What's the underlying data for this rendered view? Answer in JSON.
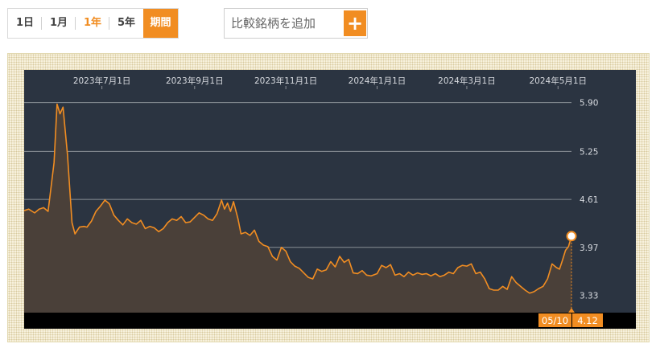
{
  "range_tabs": [
    {
      "label": "1日",
      "state": "normal"
    },
    {
      "label": "1月",
      "state": "normal"
    },
    {
      "label": "1年",
      "state": "active"
    },
    {
      "label": "5年",
      "state": "normal"
    },
    {
      "label": "期間",
      "state": "period"
    }
  ],
  "compare": {
    "placeholder": "比較銘柄を追加",
    "add_label": "+"
  },
  "colors": {
    "accent": "#f18d22",
    "plot_bg": "#2b3441",
    "grid": "#8a8f96",
    "text": "#d8dbe0",
    "area": "#4a4039"
  },
  "chart_data": {
    "type": "area",
    "x_range": [
      "2023-05-10",
      "2024-05-10"
    ],
    "ylim": [
      3.1,
      6.1
    ],
    "y_ticks": [
      5.9,
      5.25,
      4.61,
      3.97,
      3.33
    ],
    "y_tick_labels": [
      "5.90",
      "5.25",
      "4.61",
      "3.97",
      "3.33"
    ],
    "x_ticks": [
      {
        "date": "2023-07-01",
        "label": "2023年7月1日"
      },
      {
        "date": "2023-09-01",
        "label": "2023年9月1日"
      },
      {
        "date": "2023-11-01",
        "label": "2023年11月1日"
      },
      {
        "date": "2024-01-01",
        "label": "2024年1月1日"
      },
      {
        "date": "2024-03-01",
        "label": "2024年3月1日"
      },
      {
        "date": "2024-05-01",
        "label": "2024年5月1日"
      }
    ],
    "grid": true,
    "last_point": {
      "date_label": "05/10",
      "value_label": "4.12"
    },
    "series": [
      {
        "points": [
          [
            "2023-05-10",
            4.46
          ],
          [
            "2023-05-13",
            4.48
          ],
          [
            "2023-05-17",
            4.43
          ],
          [
            "2023-05-20",
            4.48
          ],
          [
            "2023-05-23",
            4.5
          ],
          [
            "2023-05-26",
            4.45
          ],
          [
            "2023-05-30",
            5.1
          ],
          [
            "2023-06-01",
            5.88
          ],
          [
            "2023-06-03",
            5.75
          ],
          [
            "2023-06-05",
            5.84
          ],
          [
            "2023-06-08",
            5.2
          ],
          [
            "2023-06-11",
            4.3
          ],
          [
            "2023-06-13",
            4.15
          ],
          [
            "2023-06-16",
            4.24
          ],
          [
            "2023-06-19",
            4.25
          ],
          [
            "2023-06-21",
            4.24
          ],
          [
            "2023-06-24",
            4.32
          ],
          [
            "2023-06-27",
            4.45
          ],
          [
            "2023-06-30",
            4.52
          ],
          [
            "2023-07-03",
            4.6
          ],
          [
            "2023-07-06",
            4.55
          ],
          [
            "2023-07-09",
            4.4
          ],
          [
            "2023-07-12",
            4.33
          ],
          [
            "2023-07-15",
            4.27
          ],
          [
            "2023-07-18",
            4.35
          ],
          [
            "2023-07-21",
            4.3
          ],
          [
            "2023-07-24",
            4.28
          ],
          [
            "2023-07-27",
            4.33
          ],
          [
            "2023-07-30",
            4.22
          ],
          [
            "2023-08-02",
            4.25
          ],
          [
            "2023-08-05",
            4.23
          ],
          [
            "2023-08-08",
            4.18
          ],
          [
            "2023-08-11",
            4.22
          ],
          [
            "2023-08-14",
            4.3
          ],
          [
            "2023-08-17",
            4.35
          ],
          [
            "2023-08-20",
            4.33
          ],
          [
            "2023-08-23",
            4.38
          ],
          [
            "2023-08-26",
            4.3
          ],
          [
            "2023-08-29",
            4.31
          ],
          [
            "2023-09-01",
            4.37
          ],
          [
            "2023-09-04",
            4.43
          ],
          [
            "2023-09-07",
            4.4
          ],
          [
            "2023-09-10",
            4.35
          ],
          [
            "2023-09-13",
            4.33
          ],
          [
            "2023-09-16",
            4.42
          ],
          [
            "2023-09-19",
            4.6
          ],
          [
            "2023-09-21",
            4.48
          ],
          [
            "2023-09-23",
            4.56
          ],
          [
            "2023-09-25",
            4.45
          ],
          [
            "2023-09-27",
            4.58
          ],
          [
            "2023-09-30",
            4.35
          ],
          [
            "2023-10-02",
            4.15
          ],
          [
            "2023-10-05",
            4.17
          ],
          [
            "2023-10-08",
            4.13
          ],
          [
            "2023-10-11",
            4.2
          ],
          [
            "2023-10-14",
            4.05
          ],
          [
            "2023-10-17",
            4.0
          ],
          [
            "2023-10-20",
            3.98
          ],
          [
            "2023-10-23",
            3.85
          ],
          [
            "2023-10-26",
            3.8
          ],
          [
            "2023-10-29",
            3.97
          ],
          [
            "2023-11-01",
            3.92
          ],
          [
            "2023-11-04",
            3.78
          ],
          [
            "2023-11-07",
            3.72
          ],
          [
            "2023-11-10",
            3.69
          ],
          [
            "2023-11-13",
            3.63
          ],
          [
            "2023-11-16",
            3.57
          ],
          [
            "2023-11-19",
            3.55
          ],
          [
            "2023-11-22",
            3.68
          ],
          [
            "2023-11-25",
            3.65
          ],
          [
            "2023-11-28",
            3.67
          ],
          [
            "2023-12-01",
            3.78
          ],
          [
            "2023-12-04",
            3.71
          ],
          [
            "2023-12-07",
            3.85
          ],
          [
            "2023-12-10",
            3.77
          ],
          [
            "2023-12-13",
            3.81
          ],
          [
            "2023-12-16",
            3.63
          ],
          [
            "2023-12-19",
            3.62
          ],
          [
            "2023-12-22",
            3.66
          ],
          [
            "2023-12-25",
            3.6
          ],
          [
            "2023-12-28",
            3.59
          ],
          [
            "2024-01-01",
            3.62
          ],
          [
            "2024-01-04",
            3.73
          ],
          [
            "2024-01-07",
            3.7
          ],
          [
            "2024-01-10",
            3.74
          ],
          [
            "2024-01-13",
            3.6
          ],
          [
            "2024-01-16",
            3.62
          ],
          [
            "2024-01-19",
            3.58
          ],
          [
            "2024-01-22",
            3.64
          ],
          [
            "2024-01-25",
            3.6
          ],
          [
            "2024-01-28",
            3.63
          ],
          [
            "2024-01-31",
            3.61
          ],
          [
            "2024-02-03",
            3.62
          ],
          [
            "2024-02-06",
            3.59
          ],
          [
            "2024-02-09",
            3.62
          ],
          [
            "2024-02-12",
            3.58
          ],
          [
            "2024-02-15",
            3.6
          ],
          [
            "2024-02-18",
            3.64
          ],
          [
            "2024-02-21",
            3.62
          ],
          [
            "2024-02-24",
            3.7
          ],
          [
            "2024-02-27",
            3.73
          ],
          [
            "2024-03-01",
            3.72
          ],
          [
            "2024-03-04",
            3.75
          ],
          [
            "2024-03-07",
            3.62
          ],
          [
            "2024-03-10",
            3.64
          ],
          [
            "2024-03-13",
            3.55
          ],
          [
            "2024-03-16",
            3.42
          ],
          [
            "2024-03-19",
            3.4
          ],
          [
            "2024-03-22",
            3.4
          ],
          [
            "2024-03-25",
            3.45
          ],
          [
            "2024-03-28",
            3.41
          ],
          [
            "2024-03-31",
            3.58
          ],
          [
            "2024-04-03",
            3.5
          ],
          [
            "2024-04-06",
            3.45
          ],
          [
            "2024-04-09",
            3.4
          ],
          [
            "2024-04-12",
            3.36
          ],
          [
            "2024-04-15",
            3.38
          ],
          [
            "2024-04-18",
            3.42
          ],
          [
            "2024-04-21",
            3.45
          ],
          [
            "2024-04-24",
            3.55
          ],
          [
            "2024-04-27",
            3.75
          ],
          [
            "2024-04-30",
            3.7
          ],
          [
            "2024-05-02",
            3.68
          ],
          [
            "2024-05-04",
            3.8
          ],
          [
            "2024-05-06",
            3.93
          ],
          [
            "2024-05-08",
            3.98
          ],
          [
            "2024-05-10",
            4.12
          ]
        ]
      }
    ]
  }
}
